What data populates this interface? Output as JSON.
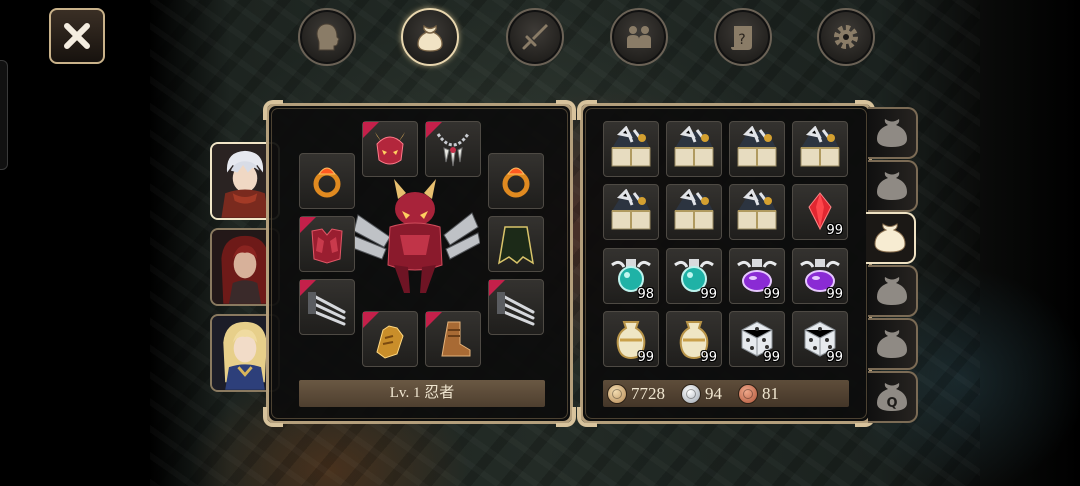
{
  "top_menu": {
    "items": [
      {
        "name": "character",
        "icon": "head-silhouette-icon",
        "active": false
      },
      {
        "name": "inventory",
        "icon": "bag-icon",
        "active": true
      },
      {
        "name": "skills",
        "icon": "sword-icon",
        "active": false
      },
      {
        "name": "party",
        "icon": "people-icon",
        "active": false
      },
      {
        "name": "quest",
        "icon": "scroll-icon",
        "active": false
      },
      {
        "name": "settings",
        "icon": "gear-icon",
        "active": false
      }
    ]
  },
  "party": {
    "members": [
      {
        "name": "white-haired-ninja",
        "selected": true
      },
      {
        "name": "red-haired-warrior",
        "selected": false
      },
      {
        "name": "blonde-elf",
        "selected": false
      }
    ]
  },
  "equipment": {
    "level_label": "Lv. 1 忍者",
    "slots": [
      {
        "item": "dragon-helmet",
        "new": true
      },
      {
        "item": "fang-necklace",
        "new": true
      },
      {
        "item": "fire-ring-left",
        "new": false
      },
      {
        "item": "fire-ring-right",
        "new": false
      },
      {
        "item": "dragon-armor",
        "new": true
      },
      {
        "item": "dark-cape",
        "new": false
      },
      {
        "item": "claw-weapon-left",
        "new": true
      },
      {
        "item": "claw-weapon-right",
        "new": true
      },
      {
        "item": "golden-gauntlet",
        "new": true
      },
      {
        "item": "leather-boots",
        "new": true
      }
    ]
  },
  "inventory": {
    "items": [
      {
        "item": "treasure-chest",
        "qty": ""
      },
      {
        "item": "treasure-chest",
        "qty": ""
      },
      {
        "item": "treasure-chest",
        "qty": ""
      },
      {
        "item": "treasure-chest",
        "qty": ""
      },
      {
        "item": "treasure-chest",
        "qty": ""
      },
      {
        "item": "treasure-chest",
        "qty": ""
      },
      {
        "item": "treasure-chest",
        "qty": ""
      },
      {
        "item": "red-crystal",
        "qty": "99"
      },
      {
        "item": "teal-potion",
        "qty": "98"
      },
      {
        "item": "teal-potion",
        "qty": "99"
      },
      {
        "item": "purple-potion",
        "qty": "99"
      },
      {
        "item": "purple-potion",
        "qty": "99"
      },
      {
        "item": "gold-vase",
        "qty": "99"
      },
      {
        "item": "gold-vase",
        "qty": "99"
      },
      {
        "item": "dice",
        "qty": "99"
      },
      {
        "item": "dice",
        "qty": "99"
      }
    ],
    "currency": {
      "gold": "7728",
      "silver": "94",
      "copper": "81"
    },
    "bag_tabs": [
      {
        "label": "",
        "active": false
      },
      {
        "label": "",
        "active": false
      },
      {
        "label": "",
        "active": true
      },
      {
        "label": "",
        "active": false
      },
      {
        "label": "",
        "active": false
      },
      {
        "label": "Q",
        "active": false
      }
    ]
  }
}
